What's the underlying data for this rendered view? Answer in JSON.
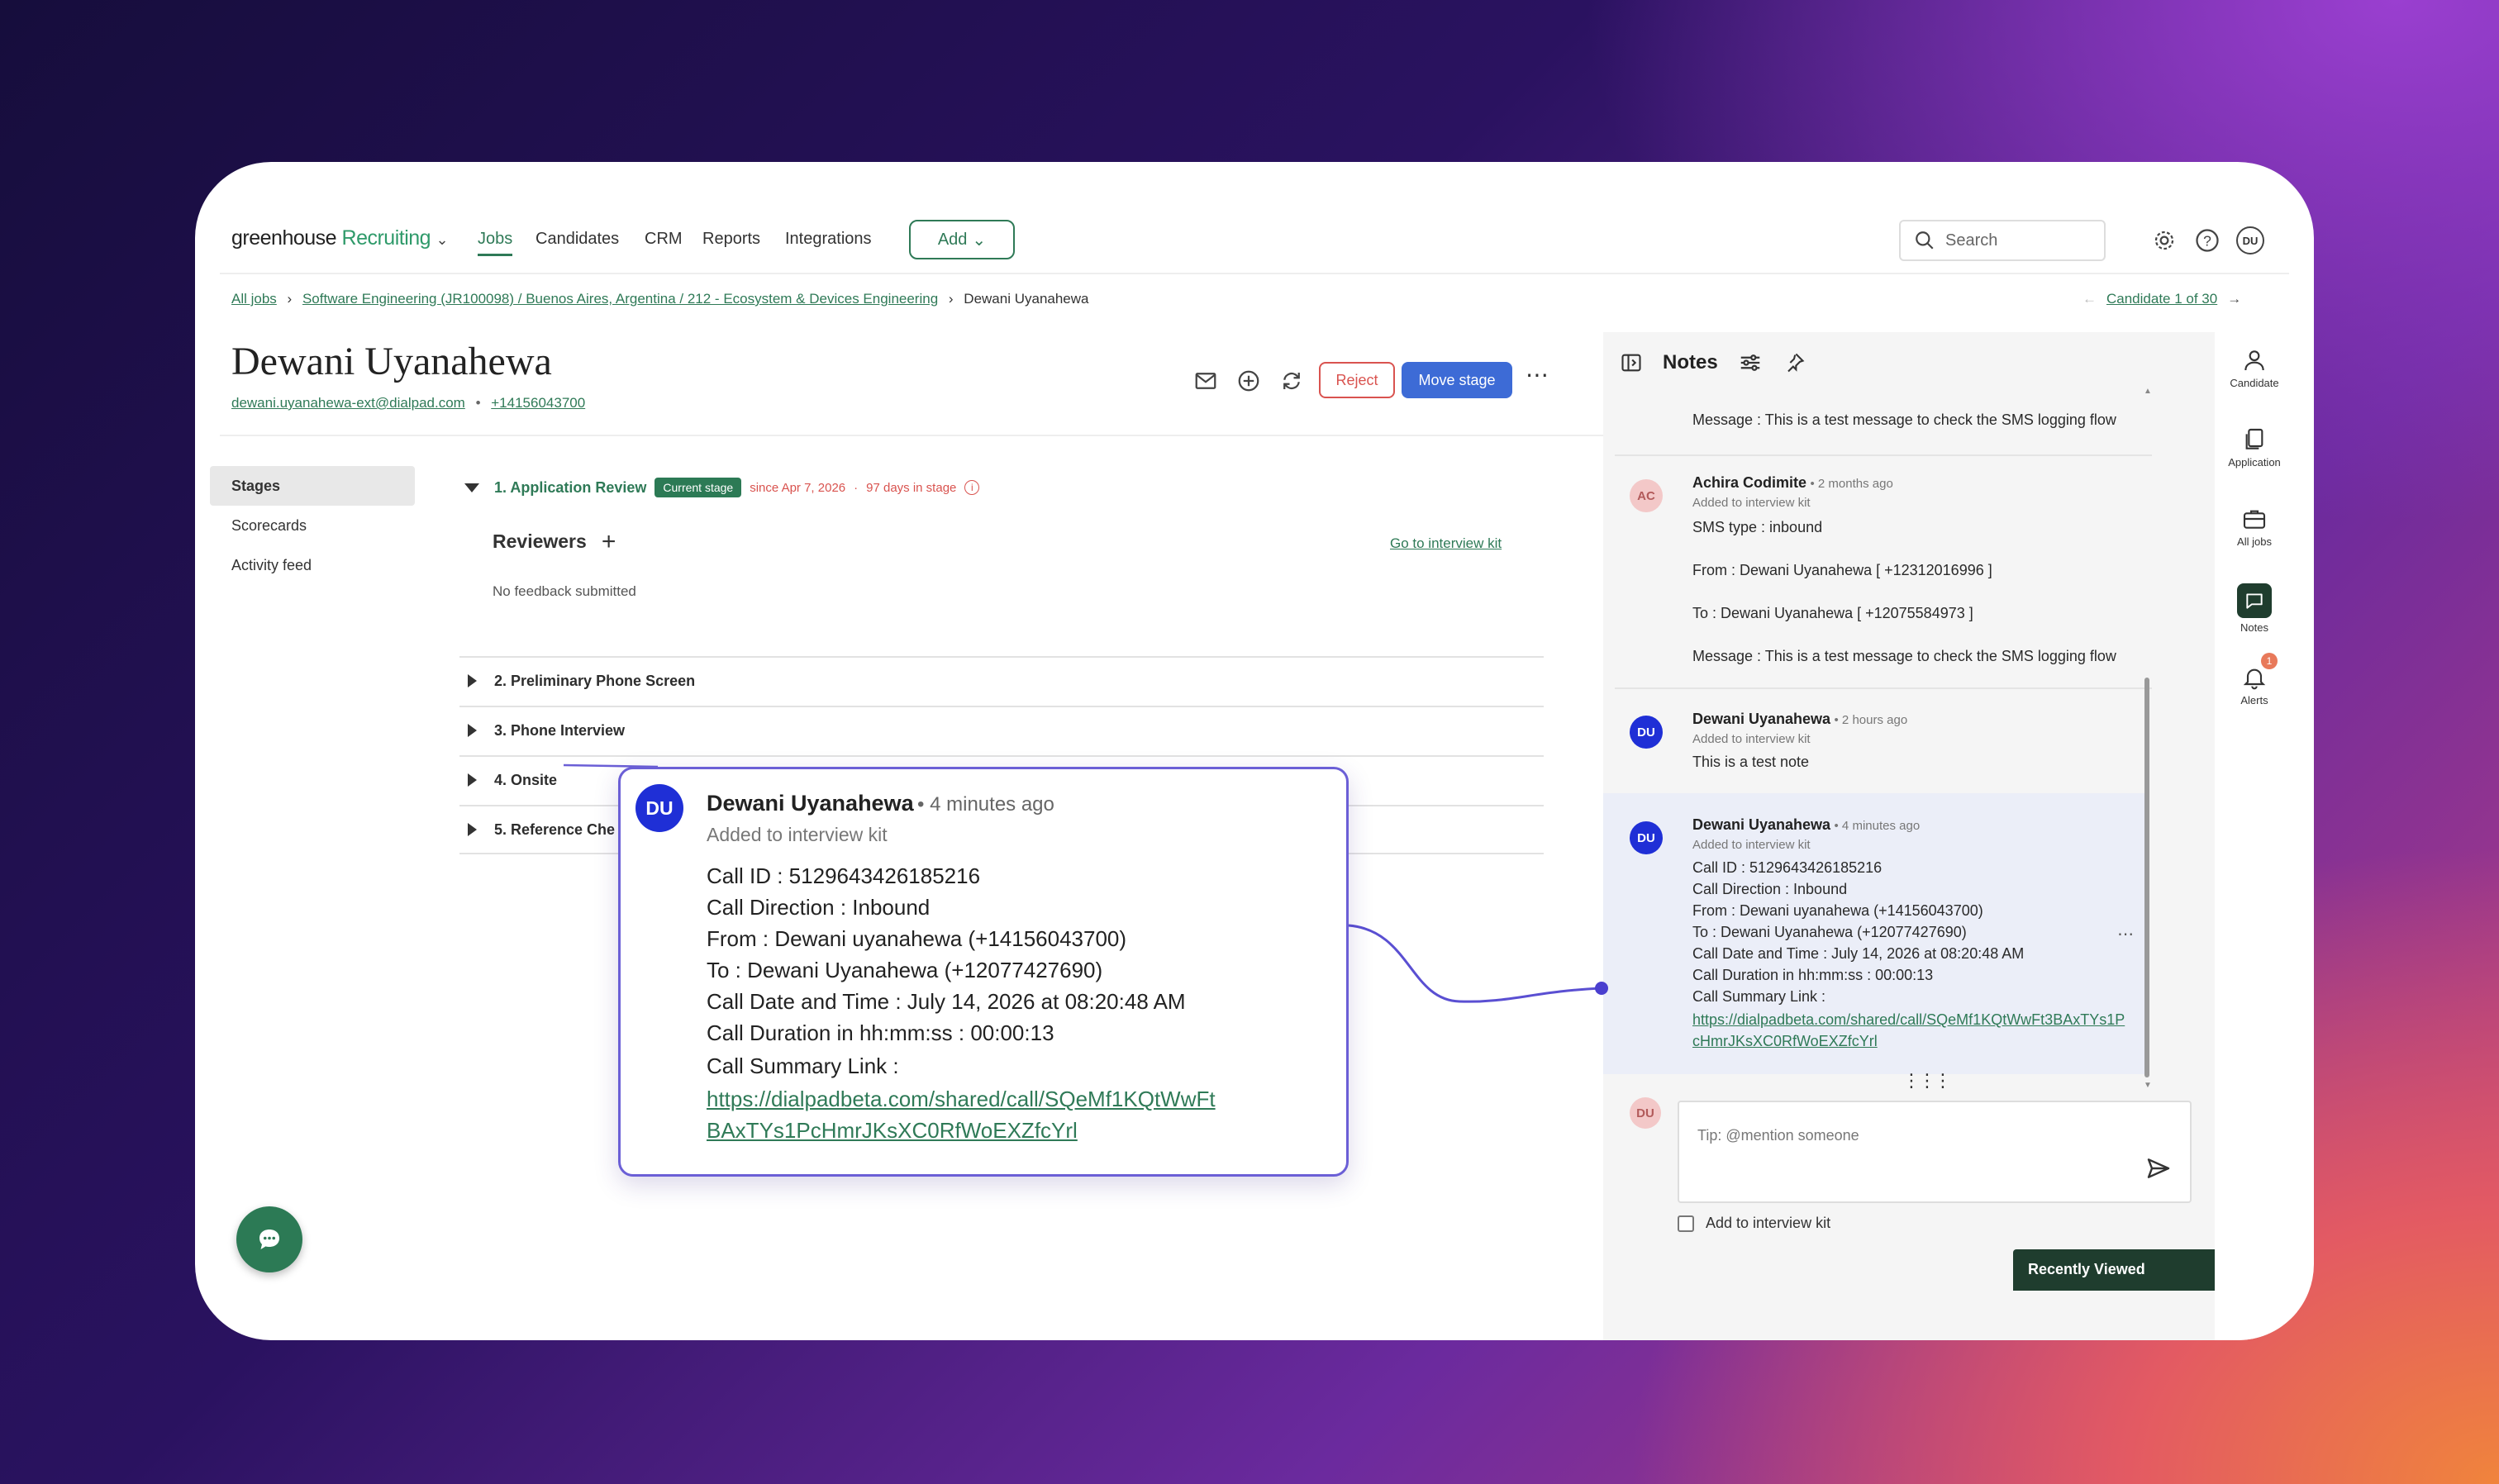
{
  "header": {
    "brand": "greenhouse",
    "brand_sub": "Recruiting",
    "nav": [
      "Jobs",
      "Candidates",
      "CRM",
      "Reports",
      "Integrations"
    ],
    "add_label": "Add",
    "search_placeholder": "Search",
    "user_initials": "DU"
  },
  "breadcrumb": {
    "all_jobs": "All jobs",
    "job": "Software Engineering (JR100098) / Buenos Aires, Argentina / 212 - Ecosystem & Devices Engineering",
    "current": "Dewani Uyanahewa",
    "candidate_pager": "Candidate 1 of 30"
  },
  "candidate": {
    "name": "Dewani Uyanahewa",
    "email": "dewani.uyanahewa-ext@dialpad.com",
    "phone": "+14156043700",
    "separator": "•",
    "reject_label": "Reject",
    "move_stage_label": "Move stage"
  },
  "left_nav": [
    "Stages",
    "Scorecards",
    "Activity feed"
  ],
  "stages": {
    "current": {
      "title": "1. Application Review",
      "badge": "Current stage",
      "since": "since Apr 7, 2026",
      "dot": "·",
      "days": "97 days in stage",
      "reviewers_label": "Reviewers",
      "interview_kit_link": "Go to interview kit",
      "feedback": "No feedback submitted"
    },
    "others": [
      "2. Preliminary Phone Screen",
      "3. Phone Interview",
      "4. Onsite",
      "5. Reference Che"
    ]
  },
  "notes_panel": {
    "title": "Notes",
    "top_message": "Message : This is a test message to check the SMS logging flow",
    "note1": {
      "initials": "AC",
      "author": "Achira Codimite",
      "time": "• 2 months ago",
      "sub": "Added to interview kit",
      "lines": [
        "SMS type : inbound",
        "From : Dewani Uyanahewa [ +12312016996 ]",
        "To : Dewani Uyanahewa [ +12075584973 ]",
        "Message : This is a test message to check the SMS logging flow"
      ]
    },
    "note2": {
      "initials": "DU",
      "author": "Dewani Uyanahewa",
      "time": "• 2 hours ago",
      "sub": "Added to interview kit",
      "body": "This is a test note"
    },
    "note3": {
      "initials": "DU",
      "author": "Dewani Uyanahewa",
      "time": "• 4 minutes ago",
      "sub": "Added to interview kit",
      "lines": [
        "Call ID : 5129643426185216",
        "Call Direction : Inbound",
        "From : Dewani uyanahewa (+14156043700)",
        "To : Dewani Uyanahewa (+12077427690)",
        "Call Date and Time : July 14, 2026 at 08:20:48 AM",
        "Call Duration in hh:mm:ss : 00:00:13",
        "Call Summary Link :"
      ],
      "link1": "https://dialpadbeta.com/shared/call/SQeMf1KQtWwFt3BAxTYs1P",
      "link2": "cHmrJKsXC0RfWoEXZfcYrl"
    },
    "composer_initials": "DU",
    "composer_placeholder": "Tip: @mention someone",
    "add_to_kit": "Add to interview kit"
  },
  "rail": {
    "items": [
      "Candidate",
      "Application",
      "All jobs",
      "Notes",
      "Alerts"
    ],
    "alert_count": "1"
  },
  "recently_viewed": "Recently Viewed",
  "popup": {
    "initials": "DU",
    "author": "Dewani Uyanahewa",
    "time": "• 4 minutes ago",
    "sub": "Added to interview kit",
    "lines": [
      "Call ID : 5129643426185216",
      "Call Direction : Inbound",
      "From : Dewani uyanahewa (+14156043700)",
      "To : Dewani Uyanahewa (+12077427690)",
      "Call Date and Time : July 14, 2026 at 08:20:48 AM",
      "Call Duration in hh:mm:ss : 00:00:13",
      "Call Summary Link :"
    ],
    "link1": "https://dialpadbeta.com/shared/call/SQeMf1KQtWwFt",
    "link2": "BAxTYs1PcHmrJKsXC0RfWoEXZfcYrl"
  },
  "colors": {
    "brand_green": "#2f7a57",
    "badge_green": "#2c7a55",
    "primary_blue": "#3d6bd6",
    "reject_red": "#d9534f",
    "popup_border": "#6b5fd6",
    "avatar_blue": "#1f2fd6"
  }
}
